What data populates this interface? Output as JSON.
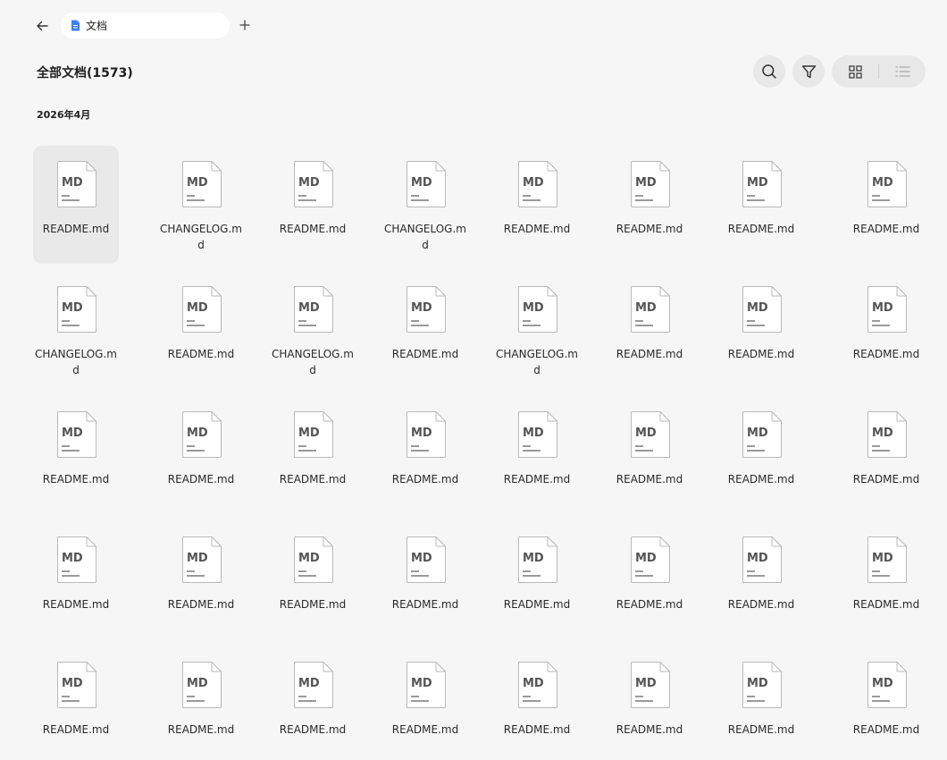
{
  "tab": {
    "title": "文档"
  },
  "header": {
    "title": "全部文档(1573)"
  },
  "section": {
    "label": "2026年4月"
  },
  "files": [
    [
      "README.md",
      "CHANGELOG.md",
      "README.md",
      "CHANGELOG.md",
      "README.md",
      "README.md",
      "README.md",
      "README.md"
    ],
    [
      "CHANGELOG.md",
      "README.md",
      "CHANGELOG.md",
      "README.md",
      "CHANGELOG.md",
      "README.md",
      "README.md",
      "README.md"
    ],
    [
      "README.md",
      "README.md",
      "README.md",
      "README.md",
      "README.md",
      "README.md",
      "README.md",
      "README.md"
    ],
    [
      "README.md",
      "README.md",
      "README.md",
      "README.md",
      "README.md",
      "README.md",
      "README.md",
      "README.md"
    ],
    [
      "README.md",
      "README.md",
      "README.md",
      "README.md",
      "README.md",
      "README.md",
      "README.md",
      "README.md"
    ]
  ],
  "file_icon_label": "MD",
  "selected_file": "0.0",
  "icons": {
    "back": "arrow-left-icon",
    "tab": "document-icon",
    "add": "plus-icon",
    "search": "search-icon",
    "filter": "filter-icon",
    "grid_view": "grid-view-icon",
    "list_view": "list-view-icon",
    "file": "markdown-file-icon"
  },
  "colors": {
    "background": "#f6f6f6",
    "tab_icon": "#3b7ff5",
    "selected_tile": "#e9e9e9",
    "button_bg": "#e8e8e8"
  }
}
